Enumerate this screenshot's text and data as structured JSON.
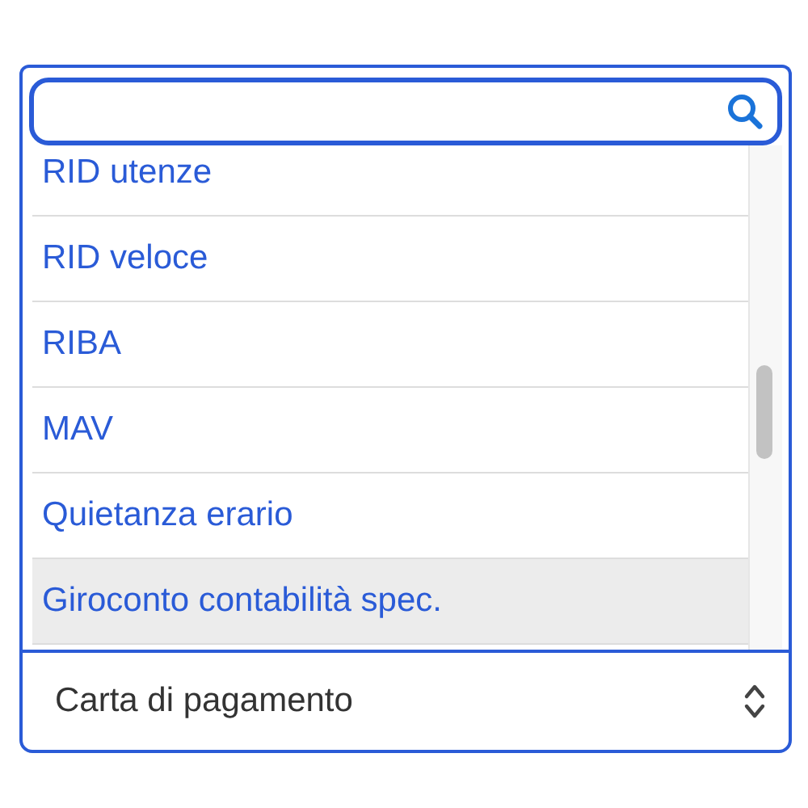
{
  "options": [
    {
      "label": "RID utenze",
      "selected": false
    },
    {
      "label": "RID veloce",
      "selected": false
    },
    {
      "label": "RIBA",
      "selected": false
    },
    {
      "label": "MAV",
      "selected": false
    },
    {
      "label": "Quietanza erario",
      "selected": false
    },
    {
      "label": "Giroconto contabilità spec.",
      "selected": true
    }
  ],
  "select": {
    "value": "Carta di pagamento"
  }
}
